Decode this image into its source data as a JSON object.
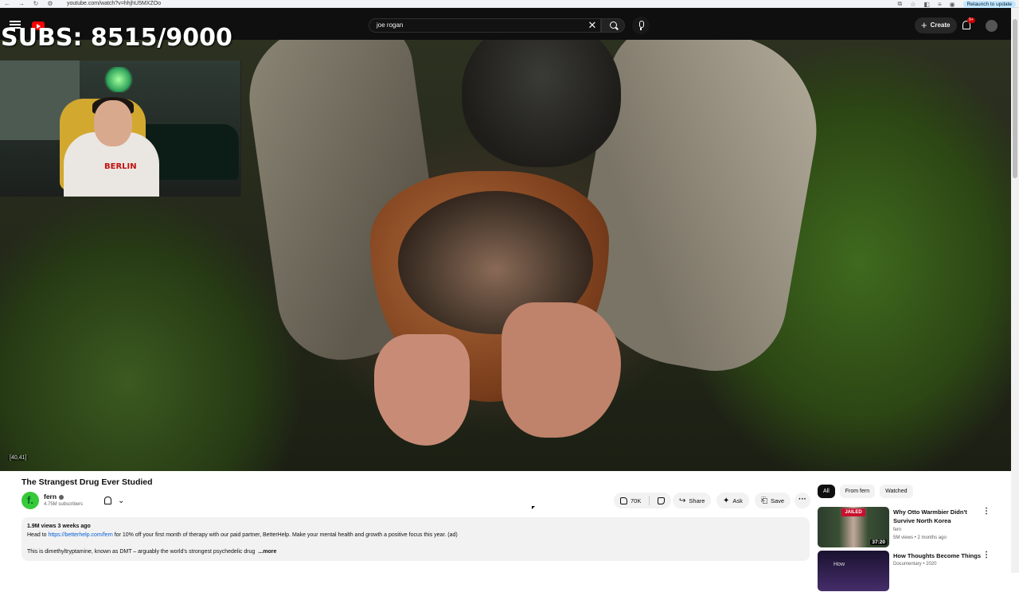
{
  "browser": {
    "url": "youtube.com/watch?v=hhjhU5MXZOo",
    "relaunch_label": "Relaunch to update"
  },
  "topbar": {
    "search_value": "joe rogan",
    "create_label": "Create",
    "notif_count": "9+"
  },
  "overlay": {
    "subs_text": "SUBS: 8515/9000",
    "webcam_shirt_text": "BERLIN"
  },
  "video": {
    "coords": "[40,41]",
    "title": "The Strangest Drug Ever Studied"
  },
  "channel": {
    "avatar_letter": "f.",
    "name": "fern",
    "subscribers": "4.75M subscribers"
  },
  "actions": {
    "likes": "70K",
    "share": "Share",
    "ask": "Ask",
    "save": "Save",
    "more_glyph": "···"
  },
  "description": {
    "meta": "1.9M views  3 weeks ago",
    "line1_prefix": "Head to ",
    "line1_link": "https://betterhelp.com/fern",
    "line1_suffix": " for 10% off your first month of therapy with our paid partner, BetterHelp. Make your mental health and growth a positive focus this year. (ad)",
    "line2": "This is dimethyltryptamine, known as DMT – arguably the world's strongest psychedelic drug",
    "more": "...more"
  },
  "sidebar": {
    "chips": [
      "All",
      "From fern",
      "Watched"
    ],
    "recommendations": [
      {
        "title": "Why Otto Warmbier Didn't Survive North Korea",
        "channel": "fern",
        "meta": "5M views • 2 months ago",
        "duration": "37:20",
        "thumb_text": "JAILED"
      },
      {
        "title": "How Thoughts Become Things",
        "channel": "Documentary • 2020",
        "meta": "",
        "duration": "",
        "thumb_text": "How"
      }
    ]
  },
  "colors": {
    "yt_dark": "#0f0f0f",
    "brand_red": "#ff0000",
    "link_blue": "#065fd4",
    "channel_green": "#36c93a"
  }
}
